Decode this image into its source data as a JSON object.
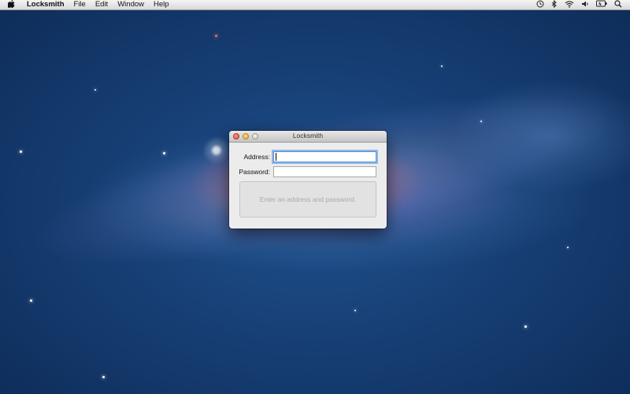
{
  "menubar": {
    "app_name": "Locksmith",
    "items": [
      "File",
      "Edit",
      "Window",
      "Help"
    ],
    "status_icons": [
      "time-machine-icon",
      "bluetooth-icon",
      "wifi-icon",
      "volume-icon",
      "battery-icon",
      "spotlight-icon"
    ]
  },
  "window": {
    "title": "Locksmith",
    "address_label": "Address:",
    "address_value": "",
    "password_label": "Password:",
    "password_value": "",
    "message": "Enter an address and password."
  },
  "colors": {
    "focus_ring": "#8fb7ea",
    "close": "#d7463c",
    "minimize": "#e0a22a",
    "zoom": "#c8c8c8"
  }
}
